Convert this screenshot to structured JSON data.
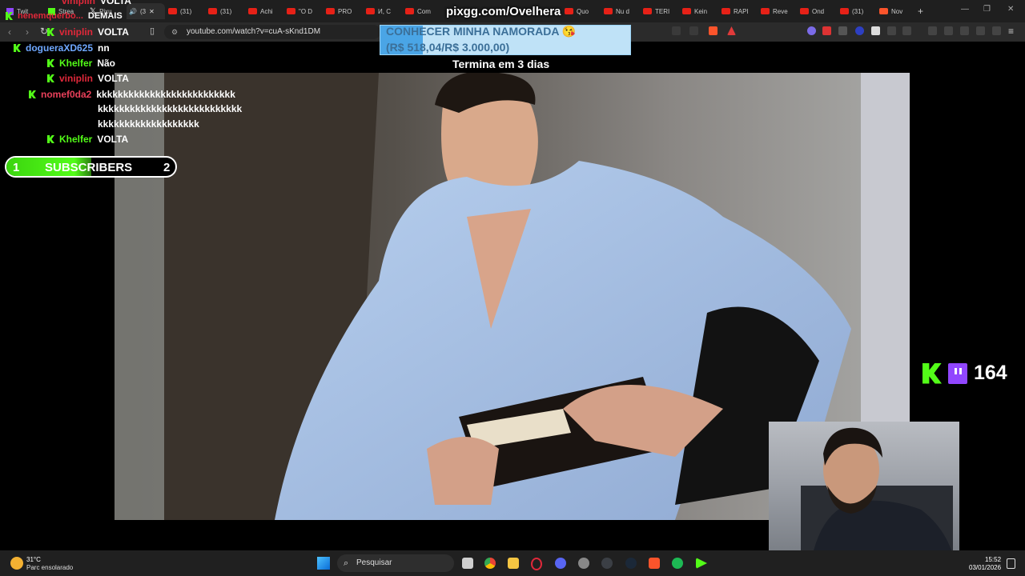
{
  "browser": {
    "tabs": [
      {
        "label": "Twit",
        "icon": "twitch-icon"
      },
      {
        "label": "Strea",
        "icon": "kick-icon"
      },
      {
        "label": "Pixu",
        "icon": "x-icon"
      },
      {
        "label": "(3",
        "icon": "speaker-icon"
      },
      {
        "label": "(31)",
        "icon": "youtube-icon"
      },
      {
        "label": "(31)",
        "icon": "youtube-icon"
      },
      {
        "label": "Achi",
        "icon": "youtube-icon"
      },
      {
        "label": "\"O D",
        "icon": "youtube-icon"
      },
      {
        "label": "PRO",
        "icon": "youtube-icon"
      },
      {
        "label": "И, С",
        "icon": "youtube-icon"
      },
      {
        "label": "Com",
        "icon": "youtube-icon"
      },
      {
        "label": "Quo",
        "icon": "youtube-icon"
      },
      {
        "label": "Nu d",
        "icon": "youtube-icon"
      },
      {
        "label": "TERI",
        "icon": "youtube-icon"
      },
      {
        "label": "Kein",
        "icon": "youtube-icon"
      },
      {
        "label": "RAPI",
        "icon": "youtube-icon"
      },
      {
        "label": "Reve",
        "icon": "youtube-icon"
      },
      {
        "label": "Ond",
        "icon": "youtube-icon"
      },
      {
        "label": "(31)",
        "icon": "youtube-icon"
      },
      {
        "label": "Nov",
        "icon": "brave-icon"
      }
    ],
    "url": "youtube.com/watch?v=cuA-sKnd1DM"
  },
  "overlay": {
    "pix_url": "pixgg.com/Ovelhera",
    "goal_title": "CONHECER MINHA NAMORADA 😘",
    "goal_amount": "(R$ 518,04/R$ 3.000,00)",
    "goal_progress": 0.17,
    "timer": "Termina em 3 dias"
  },
  "chat": [
    {
      "user": "viniplin",
      "color": "#e0283a",
      "message": "VOLTA"
    },
    {
      "user": "nenemquerbo...",
      "color": "#e0283a",
      "message": "DEMAIS"
    },
    {
      "user": "viniplin",
      "color": "#e0283a",
      "message": "VOLTA"
    },
    {
      "user": "dogueraXD625",
      "color": "#6fa8ff",
      "message": "nn"
    },
    {
      "user": "Khelfer",
      "color": "#53fc18",
      "message": "Não"
    },
    {
      "user": "viniplin",
      "color": "#e0283a",
      "message": "VOLTA"
    },
    {
      "user": "nomef0da2",
      "color": "#e8405a",
      "message": "kkkkkkkkkkkkkkkkkkkkkkkkkk",
      "cont1": "kkkkkkkkkkkkkkkkkkkkkkkkkkk",
      "cont2": "kkkkkkkkkkkkkkkkkkk"
    },
    {
      "user": "Khelfer",
      "color": "#53fc18",
      "message": "VOLTA"
    }
  ],
  "subscribers": {
    "current": "1",
    "label": "SUBSCRIBERS",
    "goal": "2",
    "progress": 0.5
  },
  "viewers": {
    "count": "164"
  },
  "taskbar": {
    "weather_temp": "31°C",
    "weather_desc": "Parc ensolarado",
    "search_placeholder": "Pesquisar",
    "time": "15:52",
    "date": "03/01/2026"
  },
  "colors": {
    "kick_green": "#53fc18",
    "twitch_purple": "#9146ff",
    "youtube_red": "#e62117"
  }
}
